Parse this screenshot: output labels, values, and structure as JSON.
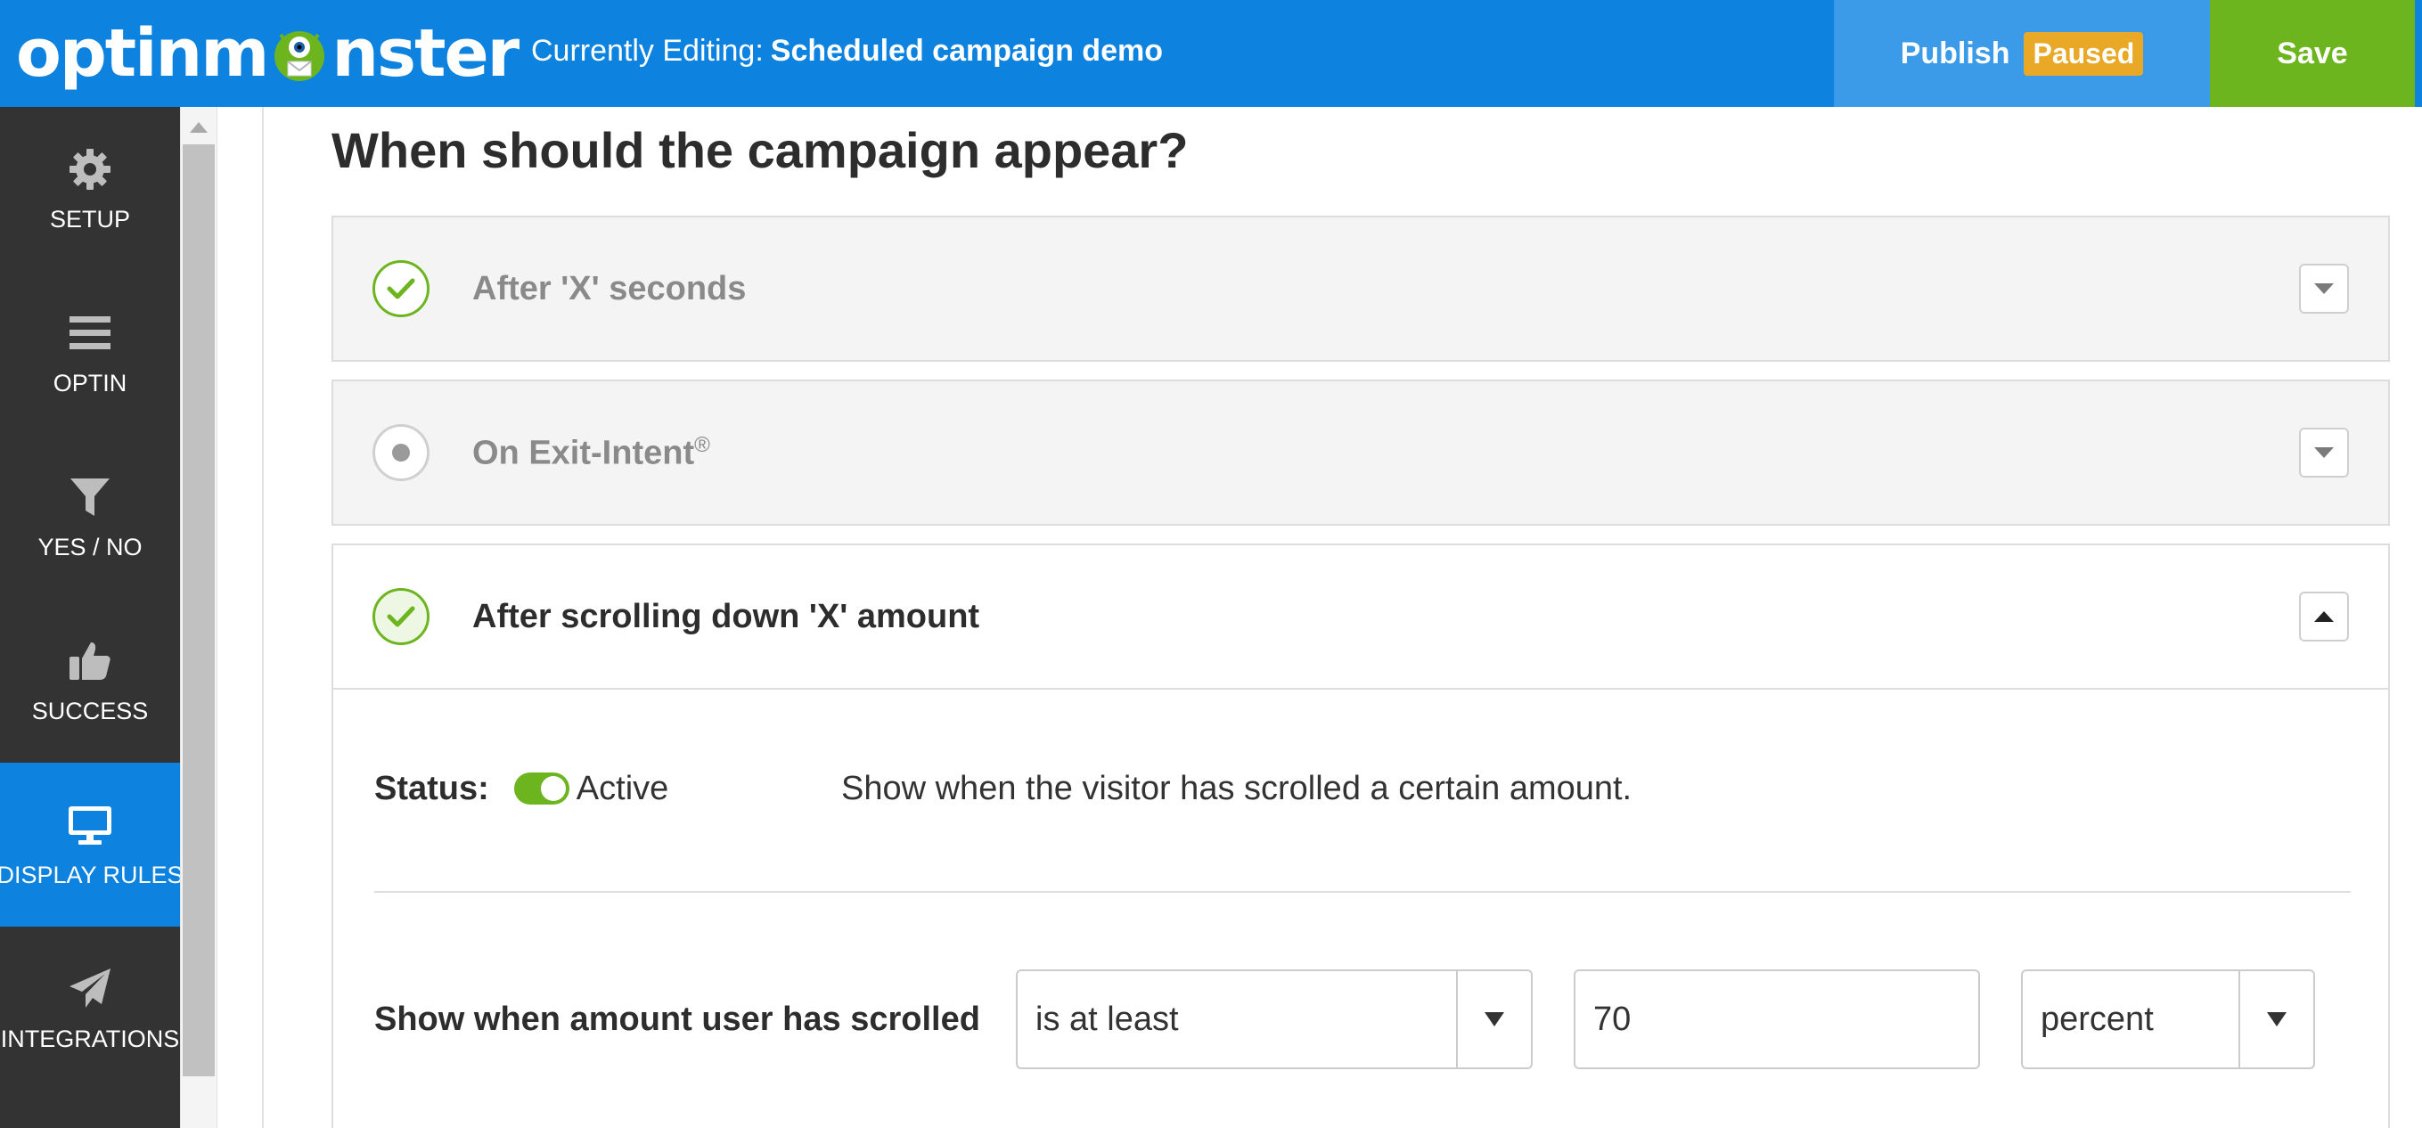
{
  "header": {
    "logo_left": "optinm",
    "logo_right": "nster",
    "editing_prefix": "Currently Editing:",
    "campaign_name": "Scheduled campaign demo",
    "publish_label": "Publish",
    "publish_status": "Paused",
    "save_label": "Save",
    "colors": {
      "brand_blue": "#0d82df",
      "publish_bg": "#3b9be8",
      "paused": "#e9a825",
      "save_green": "#6db51f"
    }
  },
  "sidebar": {
    "items": [
      {
        "label": "SETUP",
        "icon": "gear-icon",
        "active": false
      },
      {
        "label": "OPTIN",
        "icon": "menu-icon",
        "active": false
      },
      {
        "label": "YES / NO",
        "icon": "filter-icon",
        "active": false
      },
      {
        "label": "SUCCESS",
        "icon": "thumbs-up-icon",
        "active": false
      },
      {
        "label": "DISPLAY RULES",
        "icon": "monitor-icon",
        "active": true
      },
      {
        "label": "INTEGRATIONS",
        "icon": "paper-plane-icon",
        "active": false
      }
    ]
  },
  "main": {
    "heading": "When should the campaign appear?",
    "rules": [
      {
        "title": "After 'X' seconds",
        "state": "enabled",
        "expanded": false
      },
      {
        "title": "On Exit-Intent",
        "trademark": "®",
        "state": "disabled",
        "expanded": false
      },
      {
        "title": "After scrolling down 'X' amount",
        "state": "enabled",
        "expanded": true
      }
    ],
    "scroll_rule": {
      "status_label": "Status:",
      "status_value": "Active",
      "description": "Show when the visitor has scrolled a certain amount.",
      "condition_label": "Show when amount user has scrolled",
      "operator": "is at least",
      "amount": "70",
      "unit": "percent"
    }
  }
}
